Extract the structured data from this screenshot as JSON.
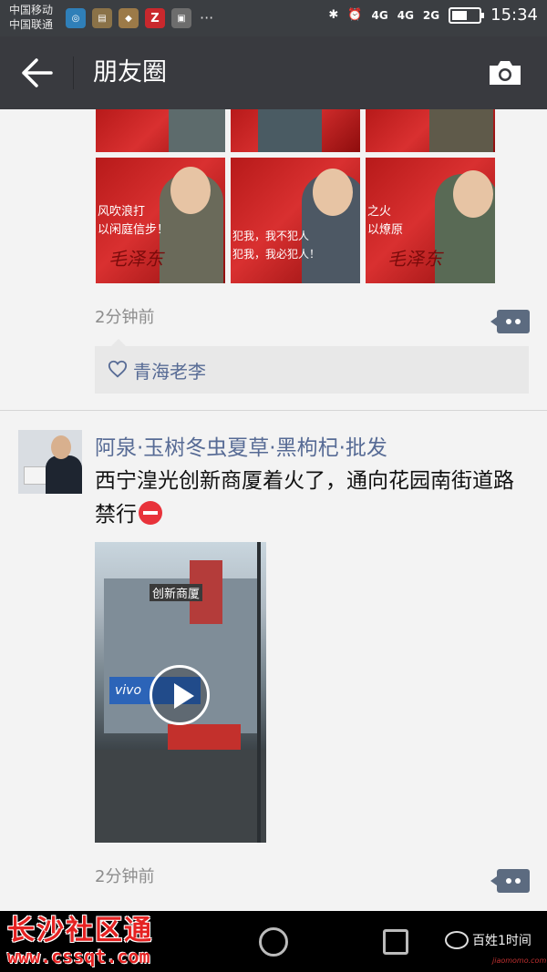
{
  "status_bar": {
    "carrier_1": "中国移动",
    "carrier_2": "中国联通",
    "notif_more": "···",
    "bluetooth": "✱",
    "alarm": "⏰",
    "signal_1": "4G",
    "signal_2": "4G",
    "signal_3": "2G",
    "battery_level": 0.55,
    "time": "15:34"
  },
  "nav": {
    "title": "朋友圈"
  },
  "post_1": {
    "timestamp": "2分钟前",
    "quotes": [
      "风吹浪打\n以闲庭信步！",
      "犯我，我不犯人\n犯我，我必犯人！",
      "之火\n以燎原"
    ],
    "likes": [
      "青海老李"
    ]
  },
  "post_2": {
    "author": "阿泉·玉树冬虫夏草·黑枸杞·批发",
    "text": "西宁湟光创新商厦着火了，通向花园南街道路禁行",
    "video_sign": "创新商厦",
    "video_brand": "vivo",
    "timestamp": "2分钟前"
  },
  "watermark": {
    "site_name": "长沙社区通",
    "site_url": "www.cssqt.com",
    "source": "百姓1时间",
    "tiny": "jiaomomo.com"
  },
  "colors": {
    "nav_bg": "#393a3f",
    "link": "#576b95",
    "poster_red": "#c72222"
  }
}
